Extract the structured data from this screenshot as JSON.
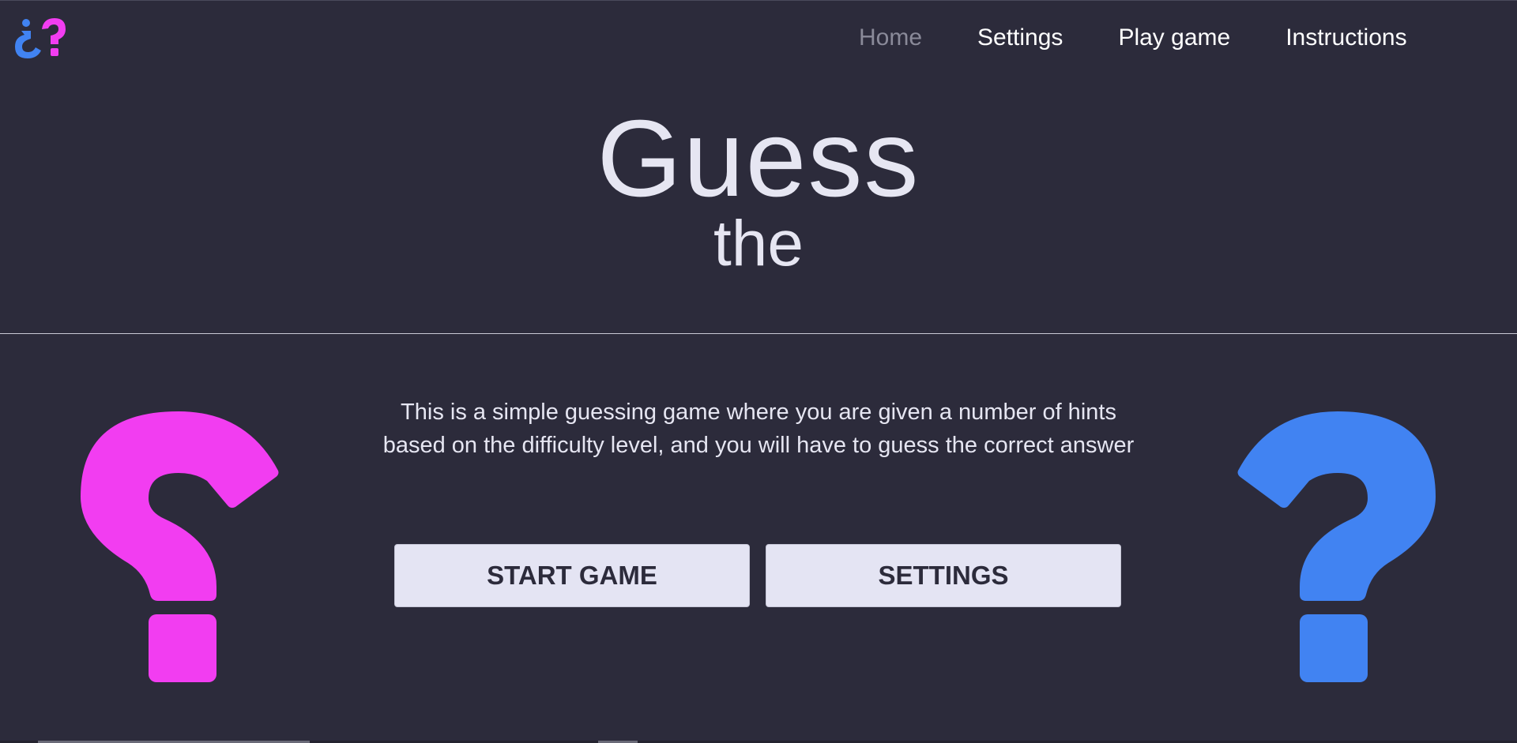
{
  "app": {
    "logo_icon": "question-marks-logo-icon",
    "colors": {
      "background": "#2c2b3b",
      "pink": "#f23df1",
      "blue": "#4183f2",
      "text": "#e6e6f2",
      "button_bg": "#e4e4f3",
      "nav_active": "#8a8a99"
    }
  },
  "nav": {
    "home": "Home",
    "settings": "Settings",
    "play": "Play game",
    "instructions": "Instructions"
  },
  "hero": {
    "line1": "Guess",
    "line2": "the"
  },
  "main": {
    "description": "This is a simple guessing game where you are given a number of hints based on the difficulty level, and you will have to guess the correct answer",
    "start_button": "START GAME",
    "settings_button": "SETTINGS"
  },
  "decor": {
    "left_icon": "pink-question-mark-icon",
    "right_icon": "blue-question-mark-icon"
  }
}
